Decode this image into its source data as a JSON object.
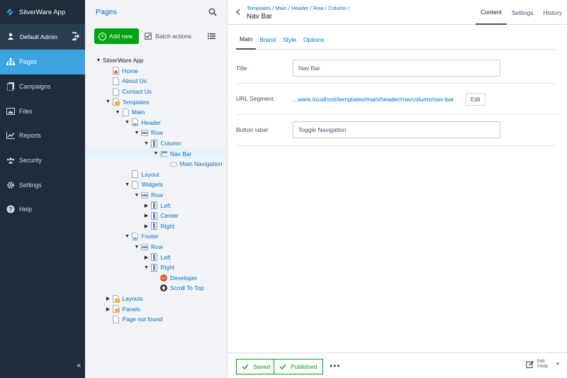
{
  "app": {
    "title": "SilverWare App"
  },
  "profile": {
    "name": "Default Admin"
  },
  "menu": {
    "items": [
      {
        "label": "Pages",
        "icon": "sitemap-icon",
        "active": true
      },
      {
        "label": "Campaigns",
        "icon": "campaigns-icon",
        "active": false
      },
      {
        "label": "Files",
        "icon": "image-icon",
        "active": false
      },
      {
        "label": "Reports",
        "icon": "chart-line-icon",
        "active": false
      },
      {
        "label": "Security",
        "icon": "users-icon",
        "active": false
      },
      {
        "label": "Settings",
        "icon": "gear-icon",
        "active": false
      },
      {
        "label": "Help",
        "icon": "help-icon",
        "active": false
      }
    ],
    "collapse_label": "«"
  },
  "tree_panel": {
    "title": "Pages",
    "add_label": "Add new",
    "batch_label": "Batch actions"
  },
  "tree": [
    {
      "label": "SilverWare App",
      "depth": 0,
      "arrow": "open",
      "icon": "none",
      "root": true
    },
    {
      "label": "Home",
      "depth": 1,
      "arrow": "none",
      "icon": "home-page"
    },
    {
      "label": "About Us",
      "depth": 1,
      "arrow": "none",
      "icon": "page"
    },
    {
      "label": "Contact Us",
      "depth": 1,
      "arrow": "none",
      "icon": "page"
    },
    {
      "label": "Templates",
      "depth": 1,
      "arrow": "open",
      "icon": "folder-page"
    },
    {
      "label": "Main",
      "depth": 2,
      "arrow": "open",
      "icon": "page"
    },
    {
      "label": "Header",
      "depth": 3,
      "arrow": "open",
      "icon": "page-blue"
    },
    {
      "label": "Row",
      "depth": 4,
      "arrow": "open",
      "icon": "row"
    },
    {
      "label": "Column",
      "depth": 5,
      "arrow": "open",
      "icon": "column"
    },
    {
      "label": "Nav Bar",
      "depth": 6,
      "arrow": "open",
      "icon": "navbar",
      "selected": true
    },
    {
      "label": "Main Navigation",
      "depth": 7,
      "arrow": "none",
      "icon": "nav"
    },
    {
      "label": "Layout",
      "depth": 3,
      "arrow": "none",
      "icon": "page"
    },
    {
      "label": "Widgets",
      "depth": 3,
      "arrow": "open",
      "icon": "page"
    },
    {
      "label": "Row",
      "depth": 4,
      "arrow": "open",
      "icon": "row"
    },
    {
      "label": "Left",
      "depth": 5,
      "arrow": "closed",
      "icon": "column"
    },
    {
      "label": "Center",
      "depth": 5,
      "arrow": "closed",
      "icon": "column"
    },
    {
      "label": "Right",
      "depth": 5,
      "arrow": "closed",
      "icon": "column"
    },
    {
      "label": "Footer",
      "depth": 3,
      "arrow": "open",
      "icon": "page-blue"
    },
    {
      "label": "Row",
      "depth": 4,
      "arrow": "open",
      "icon": "row"
    },
    {
      "label": "Left",
      "depth": 5,
      "arrow": "closed",
      "icon": "column"
    },
    {
      "label": "Right",
      "depth": 5,
      "arrow": "open",
      "icon": "column"
    },
    {
      "label": "Developer",
      "depth": 6,
      "arrow": "none",
      "icon": "developer"
    },
    {
      "label": "Scroll To Top",
      "depth": 6,
      "arrow": "none",
      "icon": "scroll-top"
    },
    {
      "label": "Layouts",
      "depth": 1,
      "arrow": "closed",
      "icon": "folder-page"
    },
    {
      "label": "Panels",
      "depth": 1,
      "arrow": "closed",
      "icon": "folder-page"
    },
    {
      "label": "Page not found",
      "depth": 1,
      "arrow": "none",
      "icon": "page"
    }
  ],
  "editor": {
    "breadcrumbs": "Templates / Main / Header / Row / Column /",
    "title": "Nav Bar",
    "top_tabs": [
      {
        "label": "Content",
        "active": true
      },
      {
        "label": "Settings",
        "active": false
      },
      {
        "label": "History",
        "active": false
      }
    ],
    "sub_tabs": [
      {
        "label": "Main",
        "active": true
      },
      {
        "label": "Brand",
        "active": false
      },
      {
        "label": "Style",
        "active": false
      },
      {
        "label": "Options",
        "active": false
      }
    ],
    "fields": {
      "title_label": "Title",
      "title_value": "Nav Bar",
      "url_label": "URL Segment",
      "url_value": "...ware.localhost/templates/main/header/row/column/nav-bar",
      "url_edit": "Edit",
      "button_label": "Button label",
      "button_value": "Toggle Navigation"
    },
    "footer": {
      "saved": "Saved",
      "published": "Published",
      "more": "•••",
      "edit_mode": "Edit mode"
    }
  },
  "colors": {
    "menu_bg": "#1e2c3b",
    "menu_active": "#3ba4df",
    "link": "#0071c4",
    "success": "#00a310"
  }
}
